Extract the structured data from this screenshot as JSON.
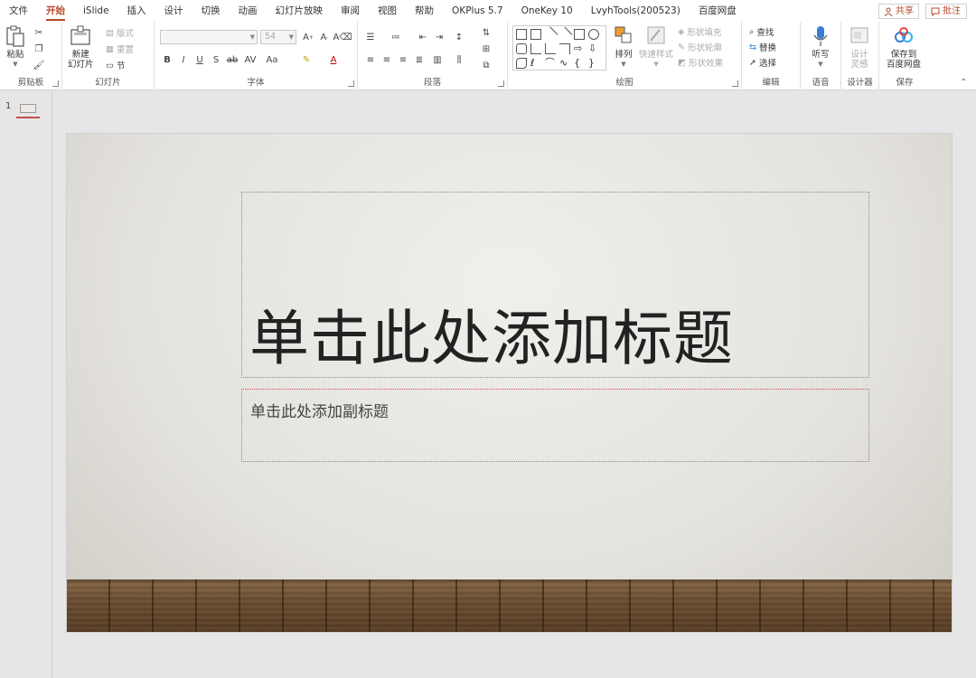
{
  "menu": {
    "tabs": [
      "文件",
      "开始",
      "iSlide",
      "插入",
      "设计",
      "切换",
      "动画",
      "幻灯片放映",
      "审阅",
      "视图",
      "帮助",
      "OKPlus 5.7",
      "OneKey 10",
      "LvyhTools(200523)",
      "百度网盘"
    ],
    "active_index": 1,
    "share_label": "共享",
    "comment_label": "批注"
  },
  "ribbon": {
    "clipboard": {
      "label": "剪贴板",
      "paste_label": "粘贴"
    },
    "slides": {
      "label": "幻灯片",
      "new_slide_label": "新建\n幻灯片",
      "new_slide_line1": "新建",
      "new_slide_line2": "幻灯片",
      "layout_label": "版式",
      "reset_label": "重置",
      "section_label": "节"
    },
    "font": {
      "label": "字体",
      "font_name_value": "",
      "font_size_value": "54"
    },
    "paragraph": {
      "label": "段落"
    },
    "drawing": {
      "label": "绘图",
      "arrange_label": "排列",
      "quick_styles_label": "快速样式",
      "shape_fill_label": "形状填充",
      "shape_outline_label": "形状轮廓",
      "shape_effects_label": "形状效果"
    },
    "editing": {
      "label": "编辑",
      "find_label": "查找",
      "replace_label": "替换",
      "select_label": "选择"
    },
    "voice": {
      "label": "语音",
      "dictate_label": "听写"
    },
    "designer": {
      "label": "设计器",
      "design_ideas_line1": "设计",
      "design_ideas_line2": "灵感"
    },
    "save": {
      "label": "保存",
      "save_line1": "保存到",
      "save_line2": "百度网盘"
    }
  },
  "thumbnails": {
    "slide_number": "1"
  },
  "slide": {
    "title_placeholder": "单击此处添加标题",
    "subtitle_placeholder": "单击此处添加副标题"
  },
  "colors": {
    "accent": "#b7472a",
    "selection_red": "#c0504d"
  }
}
